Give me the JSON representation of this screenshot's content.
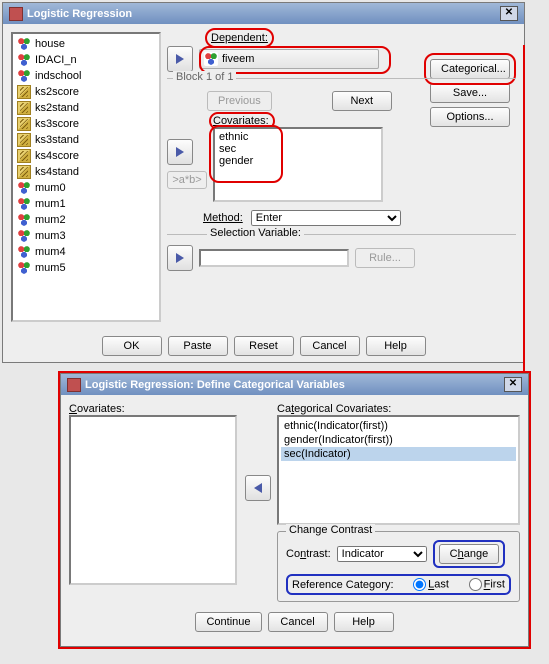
{
  "win1": {
    "title": "Logistic Regression",
    "variables": [
      {
        "name": "house",
        "type": "nominal"
      },
      {
        "name": "IDACI_n",
        "type": "nominal"
      },
      {
        "name": "indschool",
        "type": "nominal"
      },
      {
        "name": "ks2score",
        "type": "scale"
      },
      {
        "name": "ks2stand",
        "type": "scale"
      },
      {
        "name": "ks3score",
        "type": "scale"
      },
      {
        "name": "ks3stand",
        "type": "scale"
      },
      {
        "name": "ks4score",
        "type": "scale"
      },
      {
        "name": "ks4stand",
        "type": "scale"
      },
      {
        "name": "mum0",
        "type": "nominal"
      },
      {
        "name": "mum1",
        "type": "nominal"
      },
      {
        "name": "mum2",
        "type": "nominal"
      },
      {
        "name": "mum3",
        "type": "nominal"
      },
      {
        "name": "mum4",
        "type": "nominal"
      },
      {
        "name": "mum5",
        "type": "nominal"
      }
    ],
    "dependent_label": "Dependent:",
    "dependent_value": "fiveem",
    "block_label": "Block 1 of 1",
    "previous": "Previous",
    "next": "Next",
    "covariates_label": "Covariates:",
    "covariates": [
      "ethnic",
      "sec",
      "gender"
    ],
    "ab_btn": ">a*b>",
    "method_label": "Method:",
    "method_value": "Enter",
    "selection_label": "Selection Variable:",
    "rule": "Rule...",
    "side": {
      "categorical": "Categorical...",
      "save": "Save...",
      "options": "Options..."
    },
    "bottom": {
      "ok": "OK",
      "paste": "Paste",
      "reset": "Reset",
      "cancel": "Cancel",
      "help": "Help"
    }
  },
  "win2": {
    "title": "Logistic Regression: Define Categorical Variables",
    "covariates_label": "Covariates:",
    "catcov_label": "Categorical Covariates:",
    "catcov": [
      {
        "text": "ethnic(Indicator(first))",
        "selected": false
      },
      {
        "text": "gender(Indicator(first))",
        "selected": false
      },
      {
        "text": "sec(Indicator)",
        "selected": true
      }
    ],
    "change_contrast": "Change Contrast",
    "contrast_label": "Contrast:",
    "contrast_value": "Indicator",
    "change": "Change",
    "refcat_label": "Reference Category:",
    "last": "Last",
    "first": "First",
    "bottom": {
      "continue": "Continue",
      "cancel": "Cancel",
      "help": "Help"
    }
  }
}
